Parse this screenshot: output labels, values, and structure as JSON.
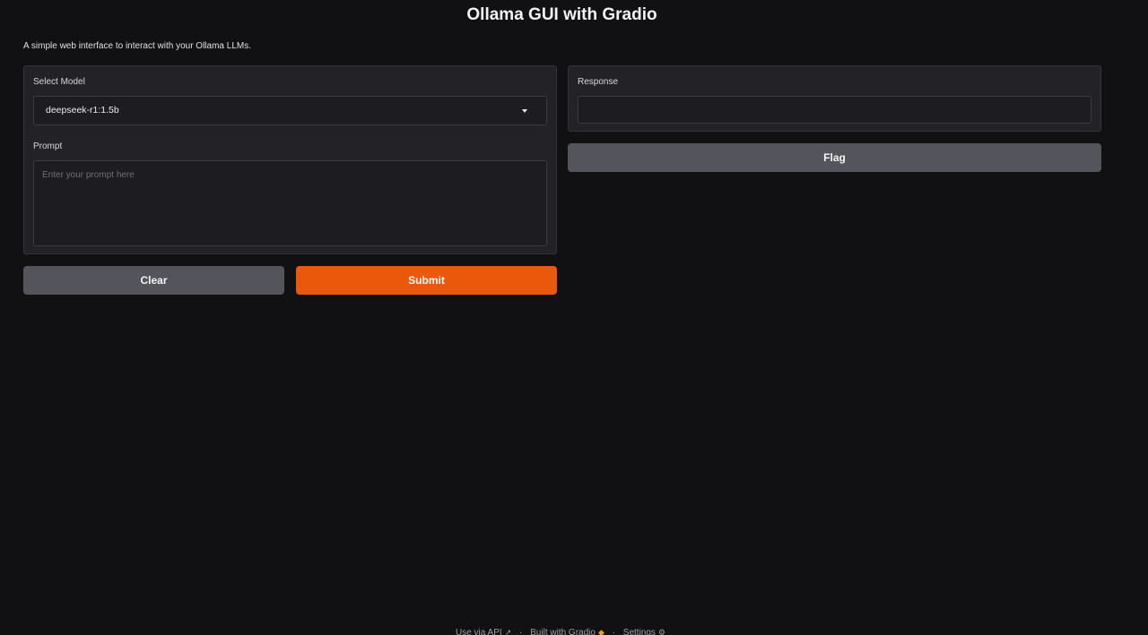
{
  "header": {
    "title": "Ollama GUI with Gradio",
    "description": "A simple web interface to interact with your Ollama LLMs."
  },
  "inputs": {
    "model": {
      "label": "Select Model",
      "value": "deepseek-r1:1.5b"
    },
    "prompt": {
      "label": "Prompt",
      "placeholder": "Enter your prompt here",
      "value": ""
    }
  },
  "outputs": {
    "response": {
      "label": "Response",
      "value": ""
    }
  },
  "buttons": {
    "clear": "Clear",
    "submit": "Submit",
    "flag": "Flag"
  },
  "footer": {
    "api": "Use via API",
    "api_icon": "rocket-icon",
    "built": "Built with Gradio",
    "built_icon": "gradio-logo-icon",
    "settings": "Settings",
    "settings_icon": "gear-icon",
    "separator": "·"
  },
  "colors": {
    "background": "#111113",
    "panel": "#232327",
    "primary_button": "#ea580c",
    "secondary_button": "#54545c"
  }
}
